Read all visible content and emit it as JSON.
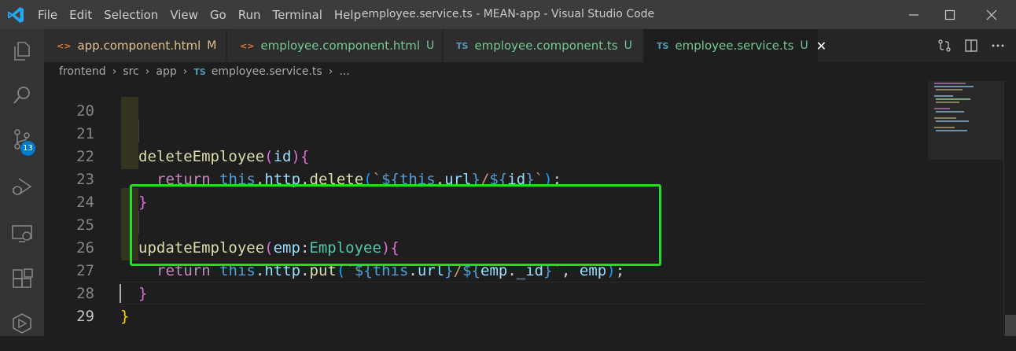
{
  "window": {
    "title": "employee.service.ts - MEAN-app - Visual Studio Code",
    "menu": [
      "File",
      "Edit",
      "Selection",
      "View",
      "Go",
      "Run",
      "Terminal",
      "Help"
    ]
  },
  "activity_bar": {
    "items": [
      "explorer-icon",
      "search-icon",
      "source-control-icon",
      "run-debug-icon",
      "remote-explorer-icon",
      "extensions-icon",
      "remote-icon"
    ],
    "source_control_badge": "13",
    "accent": "#007acc"
  },
  "tabs": [
    {
      "icon": "<>",
      "name": "app.component.html",
      "status": "M",
      "active": false
    },
    {
      "icon": "<>",
      "name": "employee.component.html",
      "status": "U",
      "active": false
    },
    {
      "icon": "TS",
      "name": "employee.component.ts",
      "status": "U",
      "active": false
    },
    {
      "icon": "TS",
      "name": "employee.service.ts",
      "status": "U",
      "active": true,
      "close": "✕"
    }
  ],
  "breadcrumb": {
    "parts": [
      "frontend",
      "src",
      "app"
    ],
    "file_icon": "TS",
    "file": "employee.service.ts",
    "more": "..."
  },
  "editor": {
    "line_numbers": [
      "20",
      "21",
      "22",
      "23",
      "24",
      "25",
      "26",
      "27",
      "28",
      "29"
    ],
    "current_line": "29",
    "highlight_color": "#22dd22",
    "code": {
      "l21": {
        "fn": "deleteEmployee",
        "open": "(",
        "param": "id",
        "close": ")",
        "brace": "{"
      },
      "l22": {
        "kw": "return",
        "this": "this",
        "dot1": ".",
        "prop1": "http",
        "dot2": ".",
        "method": "delete",
        "open": "(",
        "tick1": "`",
        "d1": "${",
        "this2": "this",
        "dot3": ".",
        "prop2": "url",
        "c1": "}",
        "slash": "/",
        "d2": "${",
        "var": "id",
        "c2": "}",
        "tick2": "`",
        "close": ")",
        "semi": ";"
      },
      "l23": {
        "brace": "}"
      },
      "l25": {
        "fn": "updateEmployee",
        "open": "(",
        "param": "emp",
        "colon": ":",
        "type": "Employee",
        "close": ")",
        "brace": "{"
      },
      "l26": {
        "kw": "return",
        "this": "this",
        "dot1": ".",
        "prop1": "http",
        "dot2": ".",
        "method": "put",
        "open": "(",
        "tick1": "`",
        "d1": "${",
        "this2": "this",
        "dot3": ".",
        "prop2": "url",
        "c1": "}",
        "slash": "/",
        "d2": "${",
        "var1": "emp",
        "dot4": ".",
        "var2": "_id",
        "c2": "}",
        "tick2": "`",
        "comma": ", ",
        "arg": "emp",
        "close": ")",
        "semi": ";"
      },
      "l27": {
        "brace": "}"
      },
      "l28": {
        "brace": "}"
      }
    }
  }
}
